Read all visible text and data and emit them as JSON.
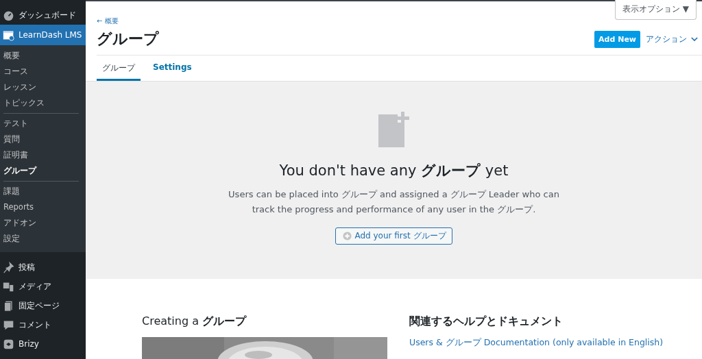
{
  "sidebar": {
    "items": [
      {
        "label": "ダッシュボード",
        "selected": false
      },
      {
        "label": "LearnDash LMS",
        "selected": true,
        "submenu": [
          [
            {
              "label": "概要",
              "selected": false
            },
            {
              "label": "コース",
              "selected": false
            },
            {
              "label": "レッスン",
              "selected": false
            },
            {
              "label": "トピックス",
              "selected": false
            }
          ],
          [
            {
              "label": "テスト",
              "selected": false
            },
            {
              "label": "質問",
              "selected": false
            },
            {
              "label": "証明書",
              "selected": false
            },
            {
              "label": "グループ",
              "selected": true
            }
          ],
          [
            {
              "label": "課題",
              "selected": false
            },
            {
              "label": "Reports",
              "selected": false
            },
            {
              "label": "アドオン",
              "selected": false
            },
            {
              "label": "設定",
              "selected": false
            }
          ]
        ]
      },
      {
        "label": "投稿",
        "selected": false
      },
      {
        "label": "メディア",
        "selected": false
      },
      {
        "label": "固定ページ",
        "selected": false
      },
      {
        "label": "コメント",
        "selected": false
      },
      {
        "label": "Brizy",
        "selected": false
      }
    ]
  },
  "screen_options": "表示オプション ▼",
  "header": {
    "back_link": "← 概要",
    "title": "グループ",
    "add_new": "Add New",
    "actions": "アクション",
    "tabs": [
      {
        "label": "グループ",
        "selected": true
      },
      {
        "label": "Settings",
        "selected": false
      }
    ]
  },
  "empty_state": {
    "heading": "You don't have any **グループ** yet",
    "text": "Users can be placed into グループ and assigned a グループ Leader who can track the progress and performance of any user in the グループ.",
    "button": "Add your first グループ"
  },
  "help": {
    "video_title": "Creating a **グループ**",
    "video": {
      "kind": "picture"
    },
    "docs_title": "関連するヘルプとドキュメント",
    "links": [
      "Users & グループ Documentation (only available in English)"
    ]
  }
}
